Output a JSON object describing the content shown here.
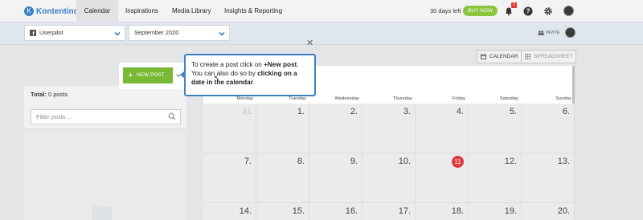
{
  "app": {
    "logo_text": "Kontentino",
    "logo_mark": "K"
  },
  "nav": {
    "tabs": [
      {
        "label": "Calendar",
        "active": true
      },
      {
        "label": "Inspirations",
        "active": false
      },
      {
        "label": "Media Library",
        "active": false
      },
      {
        "label": "Insights & Reporting",
        "active": false
      }
    ],
    "trial_text": "30 days left",
    "buy_label": "BUY NOW",
    "notification_count": "1"
  },
  "toolbar": {
    "account_select": "Userpilot",
    "month_select": "September 2020",
    "invite_label": "INVITE"
  },
  "views": {
    "calendar_label": "CALENDAR",
    "spreadsheet_label": "SPREADSHEET"
  },
  "new_post": {
    "label": "NEW POST",
    "plus": "+"
  },
  "tooltip": {
    "part1": "To create a post click on ",
    "bold1": "+New post",
    "part2": ". You can also do so by ",
    "bold2": "clicking on a date in the calendar",
    "part3": "."
  },
  "sidebar": {
    "total_label": "Total:",
    "total_value": "0 posts",
    "filter_placeholder": "Filter posts ..."
  },
  "calendar": {
    "day_names": [
      "Monday",
      "Tuesday",
      "Wednesday",
      "Thursday",
      "Friday",
      "Saturday",
      "Sunday"
    ],
    "weeks": [
      [
        "31",
        "1.",
        "2.",
        "3.",
        "4.",
        "5.",
        "6."
      ],
      [
        "7.",
        "8.",
        "9.",
        "10.",
        "11",
        "12.",
        "13."
      ],
      [
        "14.",
        "15.",
        "16.",
        "17.",
        "18.",
        "19.",
        "20."
      ]
    ],
    "today": "11"
  },
  "colors": {
    "accent": "#3b82c4",
    "buy_green": "#8cc63f",
    "newpost_green": "#7ab935",
    "today_red": "#e0393b"
  }
}
